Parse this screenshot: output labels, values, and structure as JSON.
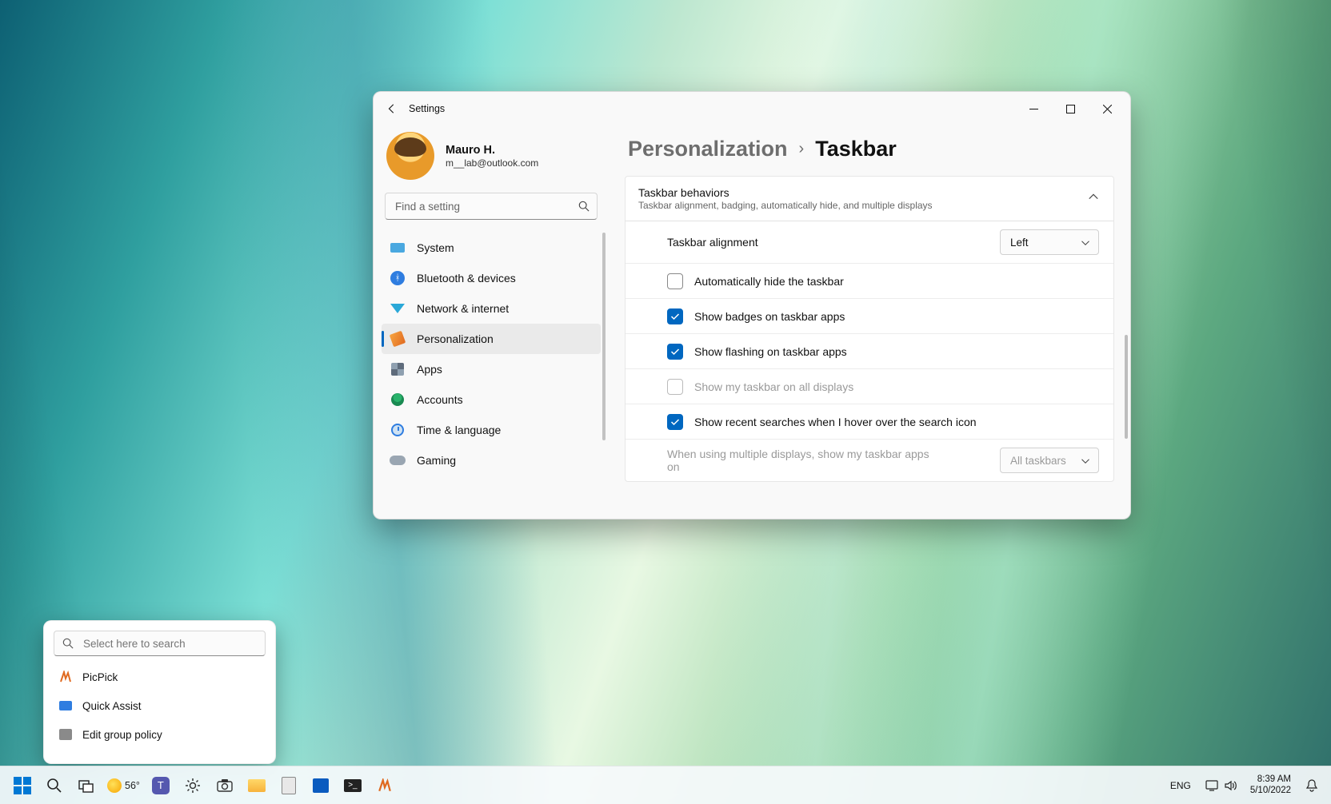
{
  "window": {
    "title": "Settings",
    "user_name": "Mauro H.",
    "user_email": "m__lab@outlook.com",
    "search_placeholder": "Find a setting",
    "nav": {
      "system": "System",
      "bluetooth": "Bluetooth & devices",
      "network": "Network & internet",
      "personalization": "Personalization",
      "apps": "Apps",
      "accounts": "Accounts",
      "time": "Time & language",
      "gaming": "Gaming"
    },
    "crumb_parent": "Personalization",
    "crumb_current": "Taskbar",
    "panel": {
      "header": "Taskbar behaviors",
      "sub": "Taskbar alignment, badging, automatically hide, and multiple displays",
      "alignment_label": "Taskbar alignment",
      "alignment_value": "Left",
      "auto_hide": "Automatically hide the taskbar",
      "badges": "Show badges on taskbar apps",
      "flashing": "Show flashing on taskbar apps",
      "all_displays": "Show my taskbar on all displays",
      "recent_search": "Show recent searches when I hover over the search icon",
      "multi_label": "When using multiple displays, show my taskbar apps on",
      "multi_value": "All taskbars"
    }
  },
  "search_flyout": {
    "placeholder": "Select here to search",
    "items": {
      "picpick": "PicPick",
      "quick_assist": "Quick Assist",
      "gpedit": "Edit group policy"
    }
  },
  "taskbar": {
    "weather": "56°",
    "lang": "ENG",
    "time": "8:39 AM",
    "date": "5/10/2022"
  }
}
